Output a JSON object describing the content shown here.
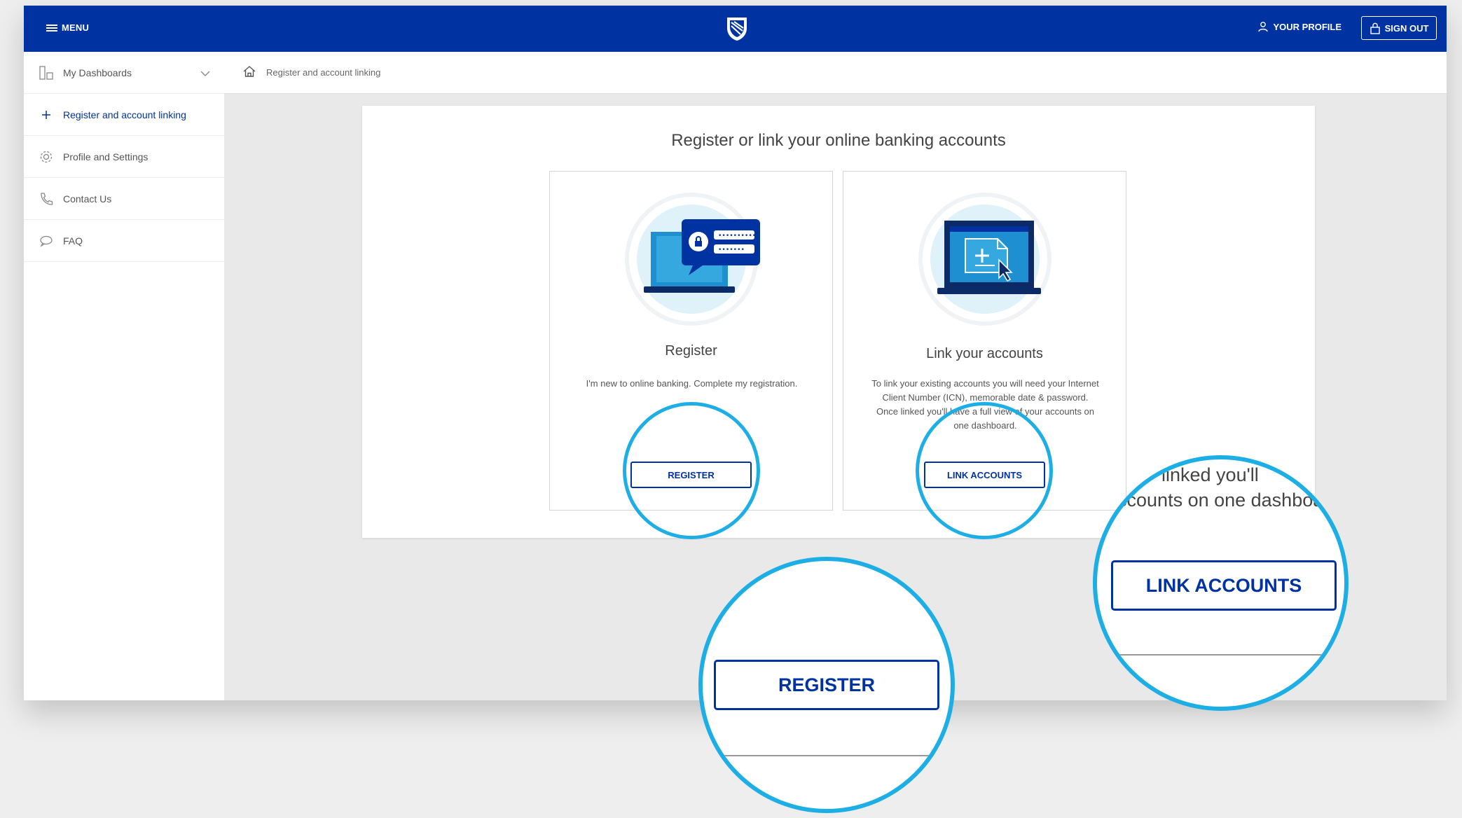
{
  "header": {
    "menu_label": "MENU",
    "profile_label": "YOUR PROFILE",
    "signout_label": "SIGN OUT",
    "brand_color": "#0033a1"
  },
  "sidebar": {
    "items": [
      {
        "label": "My Dashboards",
        "icon": "dashboard-icon"
      },
      {
        "label": "Register and account linking",
        "icon": "plus-icon"
      },
      {
        "label": "Profile and Settings",
        "icon": "gear-icon"
      },
      {
        "label": "Contact Us",
        "icon": "phone-icon"
      },
      {
        "label": "FAQ",
        "icon": "chat-icon"
      }
    ]
  },
  "breadcrumb": {
    "label": "Register and account linking",
    "icon": "home-icon"
  },
  "main": {
    "title": "Register or link your online banking accounts",
    "cards": [
      {
        "title": "Register",
        "description": "I'm new to online banking. Complete my registration.",
        "button": "REGISTER",
        "illustration": "laptop-login-illustration"
      },
      {
        "title": "Link your accounts",
        "description": "To link your existing accounts you will need your Internet Client Number (ICN), memorable date & password. Once linked you'll have a full view of your accounts on one dashboard.",
        "button": "LINK ACCOUNTS",
        "illustration": "laptop-add-illustration"
      }
    ]
  },
  "callouts": {
    "register_zoom_label": "REGISTER",
    "link_zoom_label": "LINK ACCOUNTS",
    "link_zoom_text_line1": "linked you'll",
    "link_zoom_text_line2": "accounts on one dashboard",
    "ring_color": "#1eaee6"
  }
}
